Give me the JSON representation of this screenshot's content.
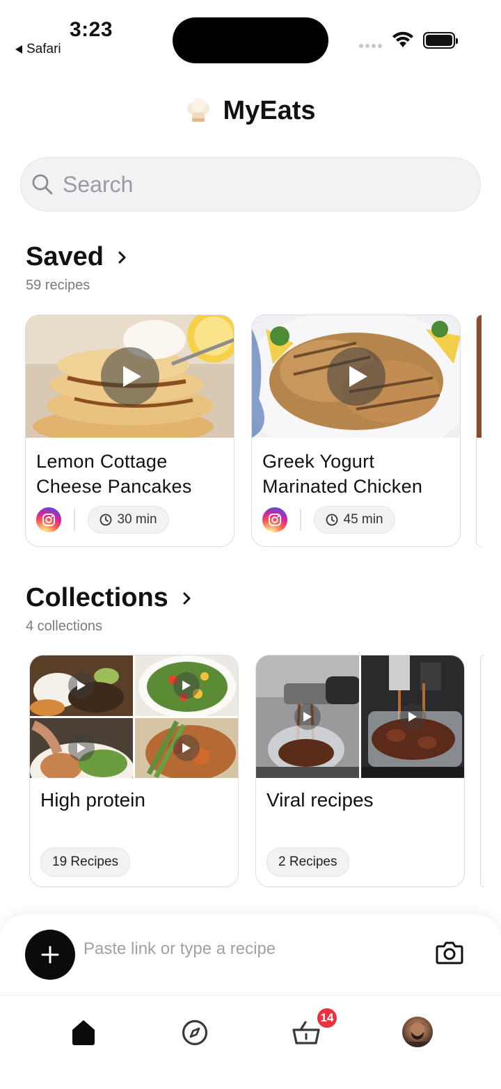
{
  "status_bar": {
    "time": "3:23",
    "back_app": "Safari"
  },
  "app": {
    "title": "MyEats"
  },
  "search": {
    "placeholder": "Search"
  },
  "saved": {
    "title": "Saved",
    "subtitle": "59 recipes",
    "recipes": [
      {
        "title_line1": "Lemon Cottage",
        "title_line2": "Cheese Pancakes",
        "source_icon": "instagram-icon",
        "time": "30 min"
      },
      {
        "title_line1": "Greek Yogurt",
        "title_line2": "Marinated Chicken",
        "source_icon": "instagram-icon",
        "time": "45 min"
      }
    ]
  },
  "collections": {
    "title": "Collections",
    "subtitle": "4 collections",
    "items": [
      {
        "name": "High protein",
        "count": "19 Recipes"
      },
      {
        "name": "Viral recipes",
        "count": "2 Recipes"
      }
    ]
  },
  "composer": {
    "placeholder": "Paste link or type a recipe"
  },
  "tabbar": {
    "basket_badge": "14",
    "tabs": [
      "home-icon",
      "compass-icon",
      "basket-icon",
      "avatar"
    ]
  },
  "colors": {
    "badge": "#e8323e",
    "primary": "#0b0b0b",
    "muted": "#7a7a7f"
  }
}
